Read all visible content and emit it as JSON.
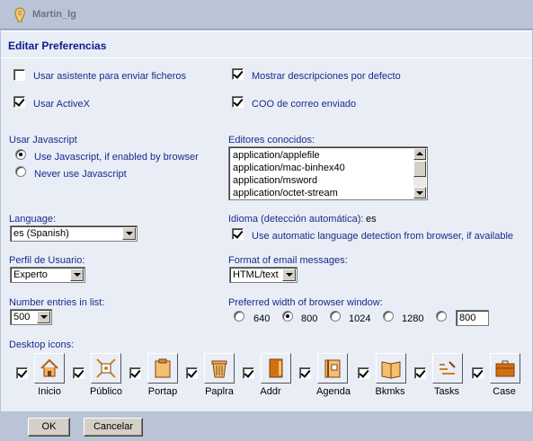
{
  "titlebar": {
    "username": "Martin_lg"
  },
  "heading": "Editar Preferencias",
  "options": {
    "usar_asistente": {
      "label": "Usar asistente para enviar ficheros",
      "checked": false
    },
    "mostrar_descripciones": {
      "label": "Mostrar descripciones por defecto",
      "checked": true
    },
    "usar_activex": {
      "label": "Usar ActiveX",
      "checked": true
    },
    "coo_correo": {
      "label": "COO de correo enviado",
      "checked": true
    }
  },
  "javascript": {
    "label": "Usar Javascript",
    "options": [
      {
        "label": "Use Javascript, if enabled by browser",
        "selected": true
      },
      {
        "label": "Never use Javascript",
        "selected": false
      }
    ]
  },
  "editors": {
    "label": "Editores conocidos:",
    "items": [
      "application/applefile",
      "application/mac-binhex40",
      "application/msword",
      "application/octet-stream"
    ]
  },
  "language": {
    "label": "Language:",
    "value": "es (Spanish)"
  },
  "idioma": {
    "label": "Idioma (detección automática):",
    "value": "es",
    "auto_label": "Use automatic language detection from browser, if available",
    "auto_checked": true
  },
  "perfil": {
    "label": "Perfil de Usuario:",
    "value": "Experto"
  },
  "email_format": {
    "label": "Format of email messages:",
    "value": "HTML/text"
  },
  "entries": {
    "label": "Number entries in list:",
    "value": "500"
  },
  "browser_width": {
    "label": "Preferred width of browser window:",
    "options": [
      {
        "label": "640",
        "selected": false
      },
      {
        "label": "800",
        "selected": true
      },
      {
        "label": "1024",
        "selected": false
      },
      {
        "label": "1280",
        "selected": false
      }
    ],
    "custom_value": "800"
  },
  "desktop": {
    "label": "Desktop icons:",
    "icons": [
      {
        "label": "Inicio",
        "icon": "home-icon",
        "checked": true
      },
      {
        "label": "Público",
        "icon": "public-icon",
        "checked": true
      },
      {
        "label": "Portap",
        "icon": "clipboard-icon",
        "checked": true
      },
      {
        "label": "Paplra",
        "icon": "trash-icon",
        "checked": true
      },
      {
        "label": "Addr",
        "icon": "address-book-icon",
        "checked": true
      },
      {
        "label": "Agenda",
        "icon": "agenda-icon",
        "checked": true
      },
      {
        "label": "Bkmks",
        "icon": "bookmarks-icon",
        "checked": true
      },
      {
        "label": "Tasks",
        "icon": "tasks-icon",
        "checked": true
      },
      {
        "label": "Case",
        "icon": "briefcase-icon",
        "checked": true
      }
    ]
  },
  "buttons": {
    "ok": "OK",
    "cancel": "Cancelar"
  },
  "colors": {
    "label_blue": "#1a2a8c",
    "panel_bg": "#e9eef6",
    "frame_bg": "#b9c4d6"
  }
}
